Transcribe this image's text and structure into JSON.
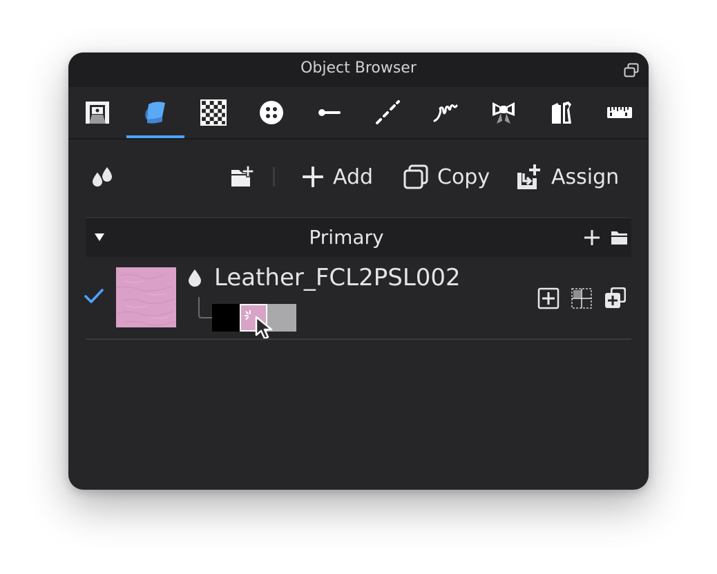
{
  "window": {
    "title": "Object Browser"
  },
  "tabs": [
    {
      "name": "tab-avatar",
      "icon": "avatar-stage-icon"
    },
    {
      "name": "tab-fabric",
      "icon": "fabric-icon",
      "active": true
    },
    {
      "name": "tab-texture",
      "icon": "checker-texture-icon"
    },
    {
      "name": "tab-button",
      "icon": "button-icon"
    },
    {
      "name": "tab-buttonhole",
      "icon": "buttonhole-icon"
    },
    {
      "name": "tab-topstitch",
      "icon": "topstitch-icon"
    },
    {
      "name": "tab-elastic",
      "icon": "elastic-icon"
    },
    {
      "name": "tab-trim",
      "icon": "bow-trim-icon"
    },
    {
      "name": "tab-pattern",
      "icon": "pattern-piece-icon"
    },
    {
      "name": "tab-measure",
      "icon": "ruler-icon"
    }
  ],
  "toolbar": {
    "add_label": "Add",
    "copy_label": "Copy",
    "assign_label": "Assign"
  },
  "group": {
    "title": "Primary"
  },
  "material": {
    "name": "Leather_FCL2PSL002",
    "checked": true,
    "thumbnail_color": "#dba0c8",
    "colorways": [
      "#000000",
      "#d8a3c6",
      "#a9a9ab"
    ]
  },
  "colors": {
    "accent": "#4da3ff",
    "panel_bg": "#262628",
    "text": "#e6e6e8"
  }
}
